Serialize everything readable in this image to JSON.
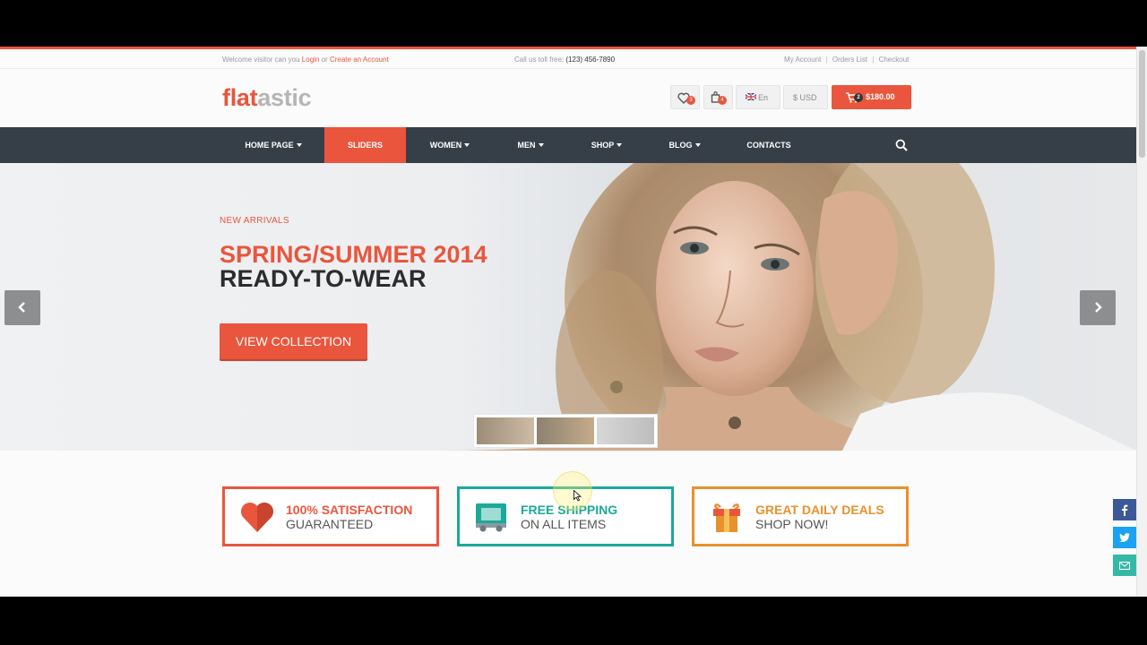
{
  "topbar": {
    "welcome_prefix": "Welcome visitor can you",
    "login": "Login",
    "or": "or",
    "create_account": "Create an Account",
    "call_label": "Call us toll free:",
    "phone": "(123) 456-7890",
    "my_account": "My Account",
    "orders_list": "Orders List",
    "checkout": "Checkout",
    "sep": "|"
  },
  "header": {
    "logo_part1": "flat",
    "logo_part2": "astic",
    "wishlist_count": "3",
    "compare_count": "4",
    "language": "En",
    "currency": "$ USD",
    "cart_count": "2",
    "cart_total": "$180.00"
  },
  "nav": {
    "items": [
      {
        "label": "HOME PAGE",
        "dropdown": true
      },
      {
        "label": "SLIDERS",
        "dropdown": false,
        "active": true
      },
      {
        "label": "WOMEN",
        "dropdown": true
      },
      {
        "label": "MEN",
        "dropdown": true
      },
      {
        "label": "SHOP",
        "dropdown": true
      },
      {
        "label": "BLOG",
        "dropdown": true
      },
      {
        "label": "CONTACTS",
        "dropdown": false
      }
    ],
    "search_icon": "search-icon"
  },
  "hero": {
    "eyebrow": "NEW ARRIVALS",
    "title_line1": "SPRING/SUMMER 2014",
    "title_line2": "READY-TO-WEAR",
    "cta": "VIEW COLLECTION",
    "prev_icon": "chevron-left-icon",
    "next_icon": "chevron-right-icon"
  },
  "features": [
    {
      "line1": "100% SATISFACTION",
      "line2": "GUARANTEED",
      "color": "#e9563d",
      "icon": "heart-icon"
    },
    {
      "line1": "FREE SHIPPING",
      "line2": "ON ALL ITEMS",
      "color": "#1aa99b",
      "icon": "truck-icon"
    },
    {
      "line1": "GREAT DAILY DEALS",
      "line2": "SHOP NOW!",
      "color": "#e8912d",
      "icon": "gift-icon"
    }
  ],
  "social": [
    "facebook-icon",
    "twitter-icon",
    "email-icon"
  ],
  "colors": {
    "accent": "#e9563d",
    "nav_bg": "#363f48",
    "teal": "#1aa99b",
    "orange": "#e8912d",
    "facebook": "#3b5998",
    "twitter": "#1da1f2",
    "email": "#35b9a7"
  }
}
